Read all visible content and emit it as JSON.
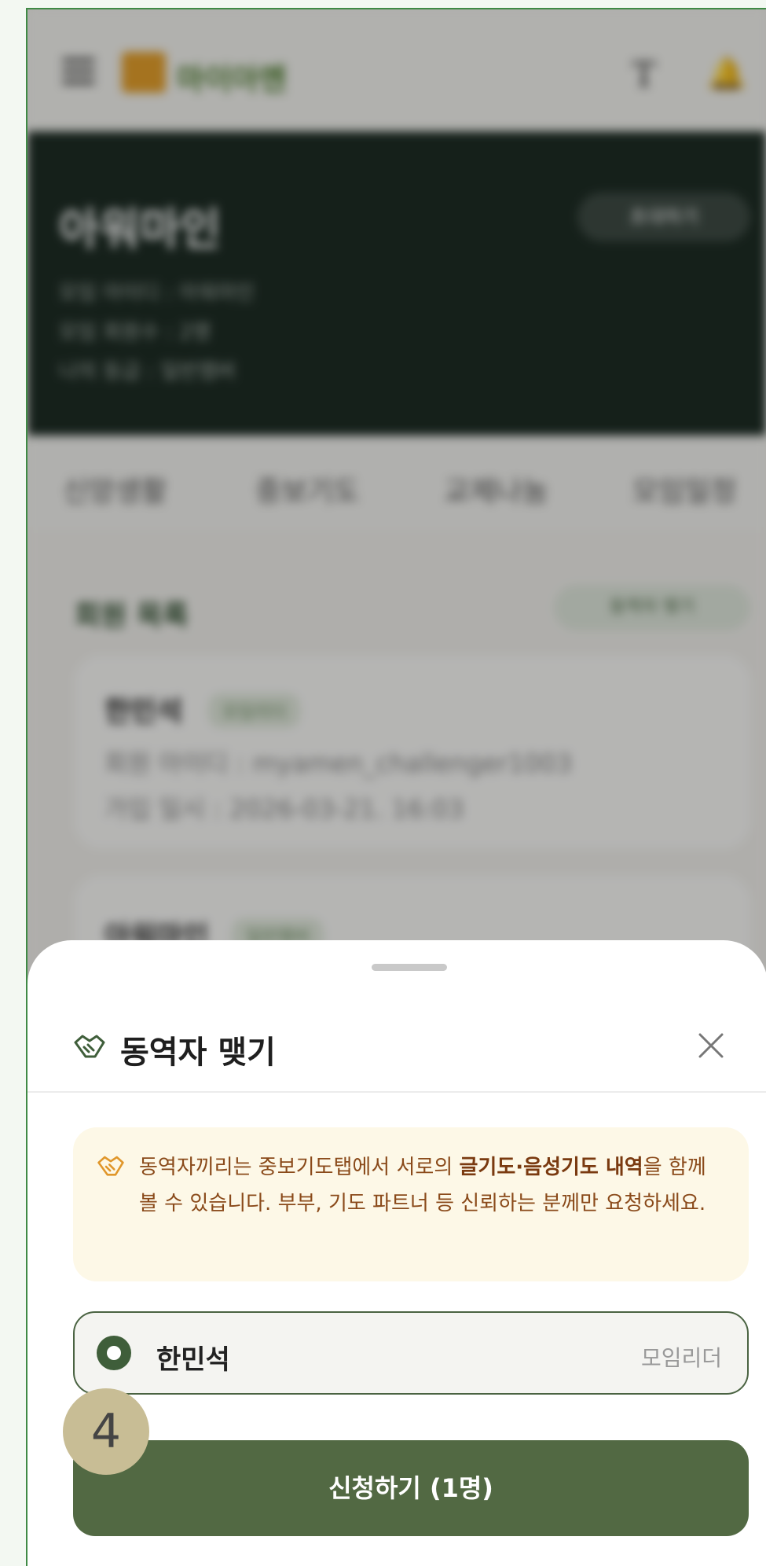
{
  "app": {
    "logo_text": "마이아멘"
  },
  "hero": {
    "title": "아워마인",
    "invite_label": "초대하기",
    "meta": [
      "모임 아이디 : 아워마인",
      "모임 회원수 : 2명",
      "나의 등급 : 일반멤버"
    ]
  },
  "tabs": [
    "신앙생활",
    "중보기도",
    "교제나눔",
    "모임일정"
  ],
  "members_section": {
    "title": "회원 목록",
    "action_label": "동역자 맺기",
    "cards": [
      {
        "name": "한민석",
        "badge": "모임리더",
        "id_line": "회원 아이디 : myamen_challenger1003",
        "date_line": "가입 일시 : 2026-03-21. 16:03"
      },
      {
        "name": "아워마인",
        "badge": "일반멤버"
      }
    ]
  },
  "sheet": {
    "title": "동역자 맺기",
    "notice": {
      "before": "동역자끼리는 중보기도탭에서 서로의 ",
      "highlight": "글기도·음성기도 내역",
      "after": "을 함께 볼 수 있습니다. 부부, 기도 파트너 등 신뢰하는 분께만 요청하세요."
    },
    "option": {
      "name": "한민석",
      "role": "모임리더",
      "selected": true
    },
    "submit_label": "신청하기 (1명)"
  },
  "step_badge": "4",
  "colors": {
    "brand_green": "#526943",
    "notice_bg": "#fdf8e7",
    "notice_text": "#8a4a1a"
  }
}
